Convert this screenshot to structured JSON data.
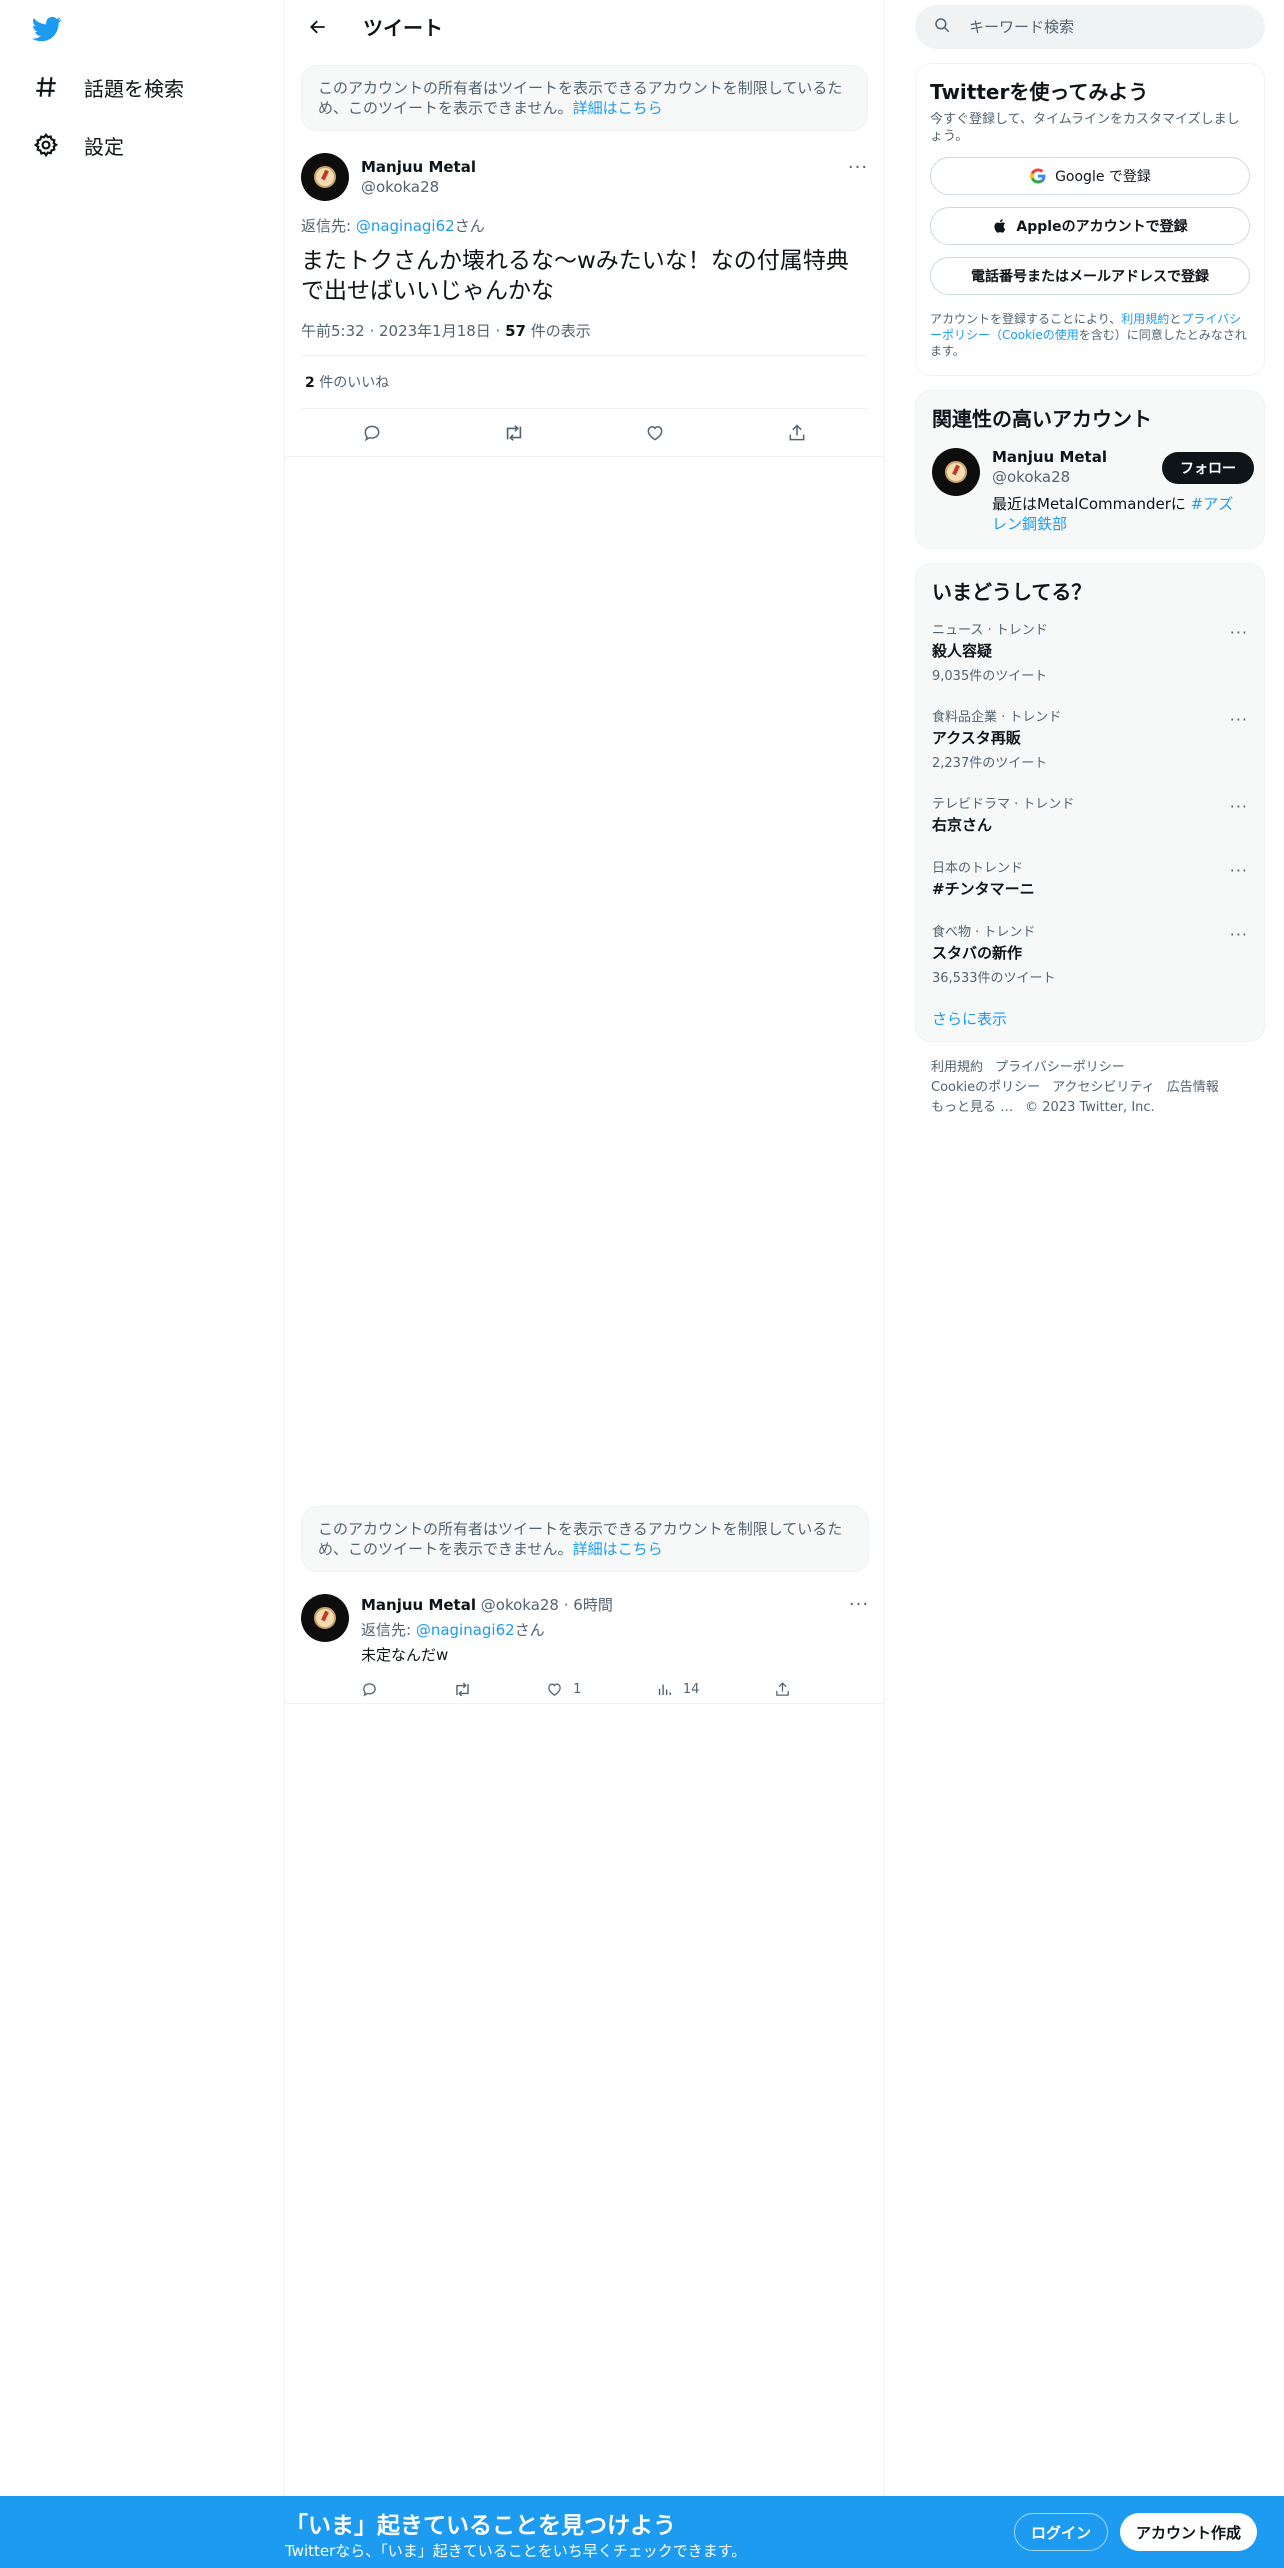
{
  "nav": {
    "explore_label": "話題を検索",
    "settings_label": "設定"
  },
  "header": {
    "title": "ツイート"
  },
  "notice": {
    "text": "このアカウントの所有者はツイートを表示できるアカウントを制限しているため、このツイートを表示できません。",
    "link": "詳細はこちら"
  },
  "tweet": {
    "author_name": "Manjuu Metal",
    "author_handle": "@okoka28",
    "reply_prefix": "返信先: ",
    "reply_handle": "@naginagi62",
    "reply_suffix": "さん",
    "text": "またトクさんか壊れるな〜wみたいな！なの付属特典で出せばいいじゃんかな",
    "time": "午前5:32 · 2023年1月18日 · ",
    "views_count": "57",
    "views_label": " 件の表示",
    "likes_count": "2",
    "likes_label": " 件のいいね"
  },
  "notice2": {
    "text": "このアカウントの所有者はツイートを表示できるアカウントを制限しているため、このツイートを表示できません。",
    "link": "詳細はこちら"
  },
  "reply": {
    "author_name": "Manjuu Metal",
    "author_handle": "@okoka28",
    "time": " · 6時間",
    "reply_prefix": "返信先: ",
    "reply_handle": "@naginagi62",
    "reply_suffix": "さん",
    "text": "未定なんだw",
    "like_count": "1",
    "views_count": "14"
  },
  "search": {
    "placeholder": "キーワード検索"
  },
  "signup": {
    "title": "Twitterを使ってみよう",
    "subtitle": "今すぐ登録して、タイムラインをカスタマイズしましょう。",
    "google_label": "Google で登録",
    "apple_label": "Appleのアカウントで登録",
    "phone_label": "電話番号またはメールアドレスで登録",
    "terms_prefix": "アカウントを登録することにより、",
    "terms_link1": "利用規約",
    "terms_and": "と",
    "terms_link2": "プライバシーポリシー",
    "terms_open": "（",
    "terms_link3": "Cookieの使用",
    "terms_suffix": "を含む）に同意したとみなされます。"
  },
  "related": {
    "title": "関連性の高いアカウント",
    "name": "Manjuu Metal",
    "handle": "@okoka28",
    "follow_label": "フォロー",
    "bio_text": "最近はMetalCommanderに ",
    "bio_tag": "#アズレン鋼鉄部"
  },
  "trends": {
    "title": "いまどうしてる？",
    "items": [
      {
        "category": "ニュース · トレンド",
        "name": "殺人容疑",
        "count": "9,035件のツイート"
      },
      {
        "category": "食料品企業 · トレンド",
        "name": "アクスタ再販",
        "count": "2,237件のツイート"
      },
      {
        "category": "テレビドラマ · トレンド",
        "name": "右京さん",
        "count": ""
      },
      {
        "category": "日本のトレンド",
        "name": "#チンタマーニ",
        "count": ""
      },
      {
        "category": "食べ物 · トレンド",
        "name": "スタバの新作",
        "count": "36,533件のツイート"
      }
    ],
    "show_more": "さらに表示"
  },
  "footer": {
    "terms": "利用規約",
    "privacy": "プライバシーポリシー",
    "cookie": "Cookieのポリシー",
    "accessibility": "アクセシビリティ",
    "ads": "広告情報",
    "more": "もっと見る …",
    "copyright": "© 2023 Twitter, Inc."
  },
  "bottom": {
    "title": "「いま」起きていることを見つけよう",
    "subtitle": "Twitterなら、「いま」起きていることをいち早くチェックできます。",
    "login_label": "ログイン",
    "signup_label": "アカウント作成"
  },
  "colors": {
    "brand": "#1d9bf0",
    "text": "#0f1419",
    "secondary": "#536471"
  }
}
